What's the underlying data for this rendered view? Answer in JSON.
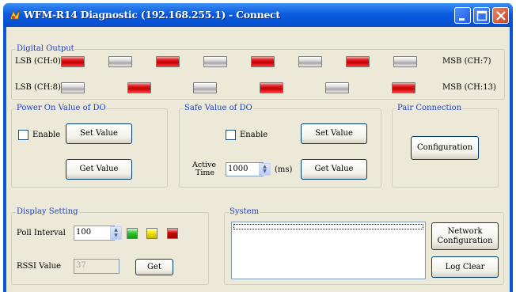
{
  "window": {
    "title": "WFM-R14 Diagnostic (192.168.255.1) - Connect"
  },
  "digital_output": {
    "label": "Digital Output",
    "row1_left": "LSB (CH:0)",
    "row1_right": "MSB (CH:7)",
    "row2_left": "LSB (CH:8)",
    "row2_right": "MSB (CH:13)",
    "row1_states": [
      "on",
      "off",
      "on",
      "off",
      "on",
      "off",
      "on",
      "off"
    ],
    "row2_states": [
      "off",
      "on",
      "off",
      "on",
      "off",
      "on"
    ]
  },
  "power_on": {
    "label": "Power On Value of DO",
    "enable": "Enable",
    "set": "Set Value",
    "get": "Get Value"
  },
  "safe_value": {
    "label": "Safe Value of DO",
    "enable": "Enable",
    "set": "Set Value",
    "get": "Get Value",
    "active1": "Active",
    "active2": "Time",
    "time_value": "1000",
    "unit": "(ms)"
  },
  "pair": {
    "label": "Pair Connection",
    "config": "Configuration"
  },
  "display": {
    "label": "Display Setting",
    "poll": "Poll Interval",
    "poll_value": "100",
    "rssi": "RSSI Value",
    "rssi_value": "37",
    "get": "Get",
    "colors": {
      "green": "#2cc82c",
      "yellow": "#f2e600",
      "red": "#d00000"
    }
  },
  "system": {
    "label": "System",
    "net1": "Network",
    "net2": "Configuration",
    "log": "Log Clear"
  },
  "colors": {
    "title_bar": "#0a5ce0",
    "group_label": "#1a3fd0",
    "dialog_bg": "#ece9d8"
  },
  "icons": [
    "app-icon",
    "minimize-icon",
    "maximize-icon",
    "close-icon"
  ]
}
